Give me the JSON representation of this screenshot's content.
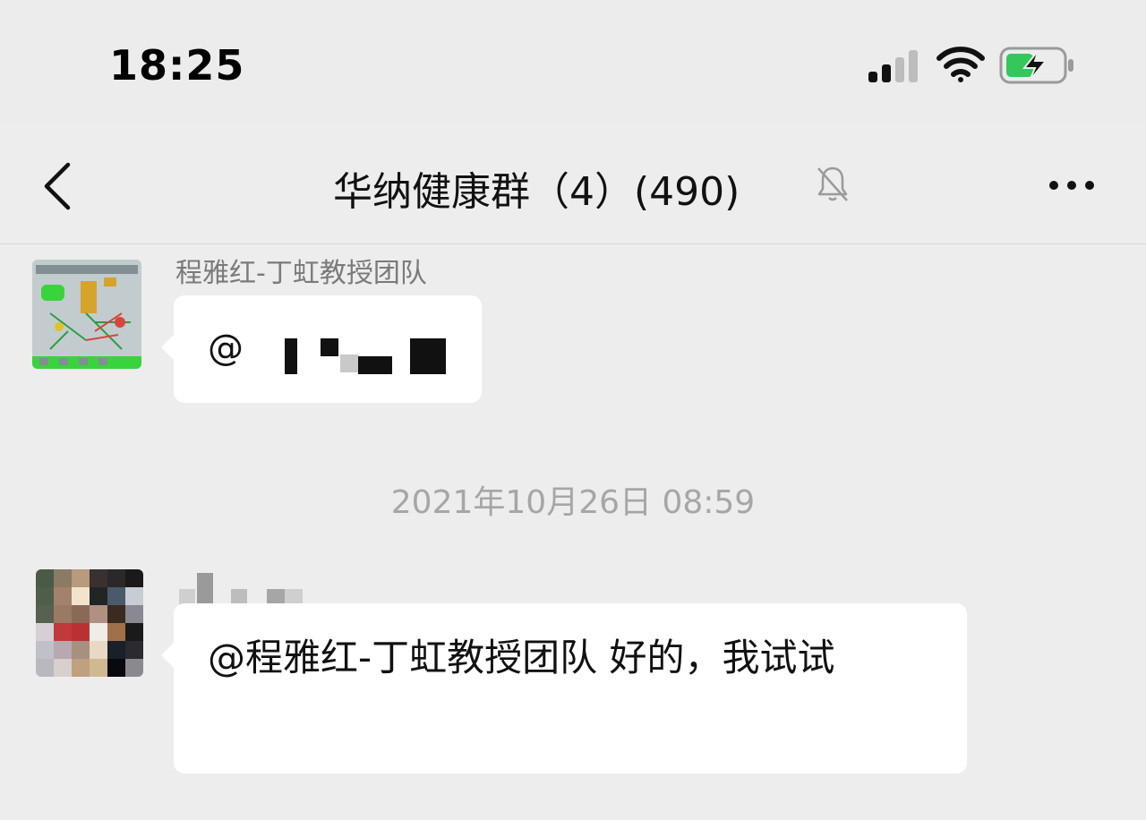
{
  "status_bar": {
    "time": "18:25",
    "signal_icon": "cellular-signal-icon",
    "wifi_icon": "wifi-icon",
    "battery_icon": "battery-charging-icon"
  },
  "header": {
    "back_icon": "chevron-left-icon",
    "title": "华纳健康群（4）(490)",
    "mute_icon": "bell-slash-icon",
    "more_icon": "ellipsis-icon"
  },
  "messages": [
    {
      "sender": "程雅红-丁虹教授团队",
      "text": "@",
      "avatar_icon": "pathway-diagram-avatar"
    },
    {
      "timestamp": "2021年10月26日 08:59"
    },
    {
      "sender": "",
      "text": "@程雅红-丁虹教授团队 好的，我试试",
      "avatar_icon": "pixelated-photo-avatar"
    }
  ],
  "colors": {
    "page_bg": "#ededed",
    "bubble_bg": "#ffffff",
    "battery_green": "#34c759",
    "muted_text": "#7a7a7a",
    "timestamp_text": "#a6a6a6"
  }
}
